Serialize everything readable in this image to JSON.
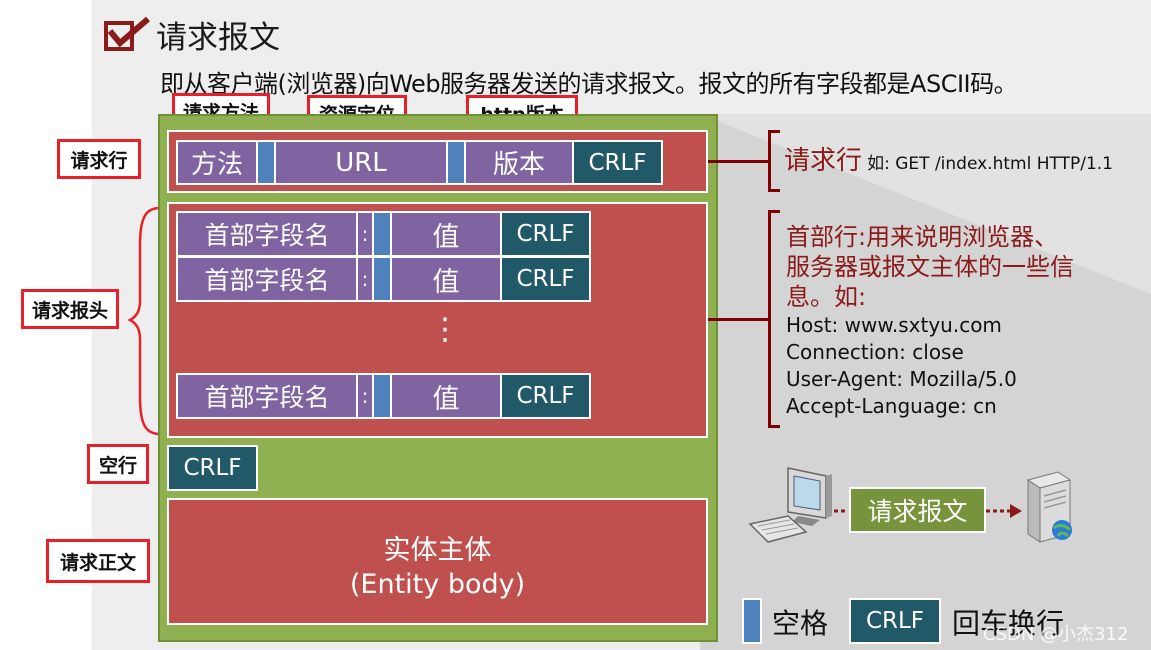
{
  "title": "请求报文",
  "subtitle": "即从客户端(浏览器)向Web服务器发送的请求报文。报文的所有字段都是ASCII码。",
  "top_labels": {
    "method": "请求方法",
    "resource": "资源定位",
    "version": "http版本"
  },
  "left_labels": {
    "request_line": "请求行",
    "request_header": "请求报头",
    "blank_line": "空行",
    "request_body": "请求正文"
  },
  "request_line": {
    "method": "方法",
    "url": "URL",
    "version": "版本",
    "crlf": "CRLF"
  },
  "header_rows": [
    {
      "name": "首部字段名",
      "colon": ":",
      "value": "值",
      "crlf": "CRLF"
    },
    {
      "name": "首部字段名",
      "colon": ":",
      "value": "值",
      "crlf": "CRLF"
    },
    {
      "name": "首部字段名",
      "colon": ":",
      "value": "值",
      "crlf": "CRLF"
    }
  ],
  "ellipsis": "⋮",
  "blank_crlf": "CRLF",
  "body": {
    "line1": "实体主体",
    "line2": "(Entity body)"
  },
  "right": {
    "request_line_title": "请求行",
    "request_line_example": "如: GET /index.html HTTP/1.1",
    "header_desc_lines": [
      "首部行:用来说明浏览器、",
      "服务器或报文主体的一些信",
      "息。如:"
    ],
    "header_examples": [
      "Host: www.sxtyu.com",
      "Connection: close",
      "User-Agent:  Mozilla/5.0",
      "Accept-Language:  cn"
    ]
  },
  "network": {
    "label": "请求报文"
  },
  "legend": {
    "space": "空格",
    "crlf": "CRLF",
    "crlf_desc": "回车换行"
  },
  "watermark": "CSDN @小杰312",
  "colors": {
    "purple": "#8064a2",
    "teal": "#215968",
    "blue": "#4f81bd",
    "red": "#c0504d",
    "green": "#8fb050",
    "label_border": "#e8202a",
    "annotation": "#800000"
  }
}
